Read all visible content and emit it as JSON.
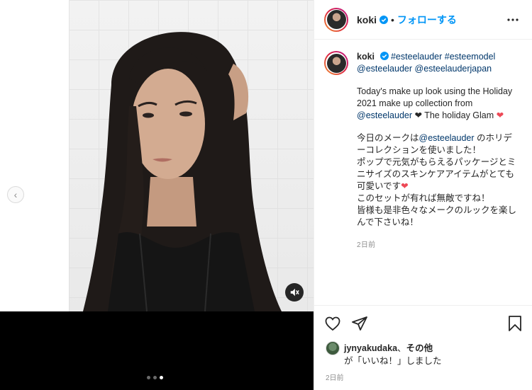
{
  "post": {
    "username": "koki",
    "separator": "•",
    "follow_label": "フォローする"
  },
  "caption": {
    "username": "koki",
    "hashtag1": "#esteelauder",
    "hashtag2": "#esteemodel",
    "mention1": "@esteelauder",
    "mention2": "@esteelauderjapan",
    "en_line1": "Today's make up look using the Holiday",
    "en_line2": "2021 make up collection from",
    "en_mention": "@esteelauder",
    "en_tail": " ❤ The holiday Glam ",
    "heart": "❤",
    "jp_pre": "今日のメークは",
    "jp_mention": "@esteelauder",
    "jp_line1_tail": " のホリデ",
    "jp_line2": "ーコレクションを使いました！",
    "jp_line3": "ポップで元気がもらえるパッケージとミ",
    "jp_line4": "ニサイズのスキンケアアイテムがとても",
    "jp_line5": "可愛いです",
    "jp_line6": "このセットが有れば無敵ですね！",
    "jp_line7": "皆様も是非色々なメークのルックを楽し",
    "jp_line8": "んで下さいね！",
    "time": "2日前"
  },
  "likes": {
    "liker": "jynyakudaka",
    "connector": "、",
    "others": "その他",
    "suffix": "が「いいね！」しました"
  },
  "date": "2日前",
  "colors": {
    "accent": "#0095f6",
    "heart": "#ed4956",
    "link": "#00376b"
  },
  "icons": [
    "verified-badge-icon",
    "more-options-icon",
    "heart-icon",
    "comment-icon",
    "share-icon",
    "bookmark-icon",
    "chevron-left-icon",
    "muted-speaker-icon"
  ]
}
